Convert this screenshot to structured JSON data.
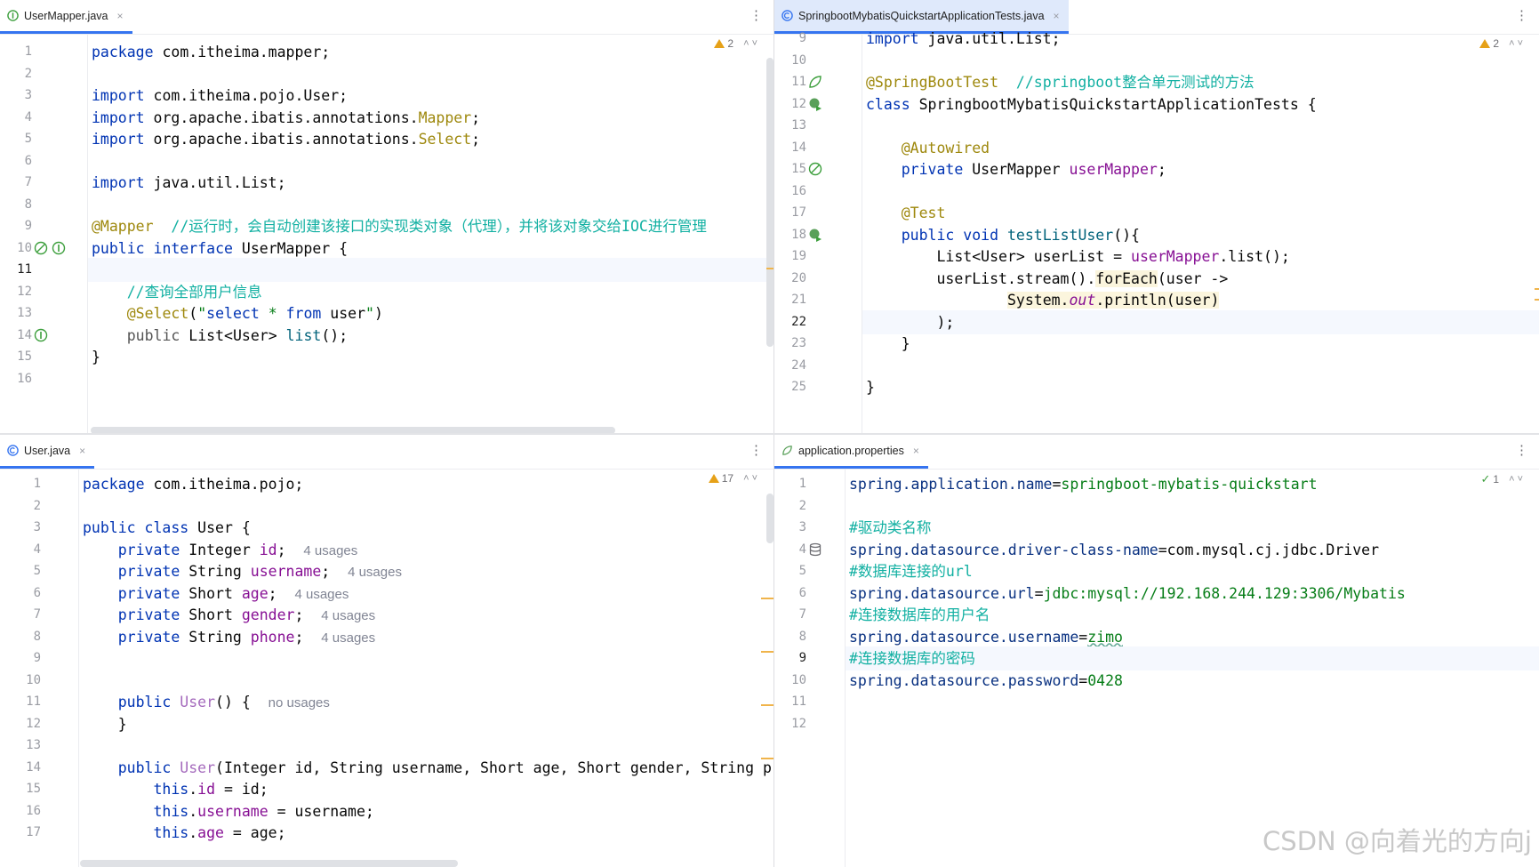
{
  "panes": {
    "mapper": {
      "tab": "UserMapper.java",
      "warnings": "2",
      "lines": [
        {
          "n": "1",
          "html": "<span class='kw'>package</span> com.itheima.mapper;"
        },
        {
          "n": "2",
          "html": ""
        },
        {
          "n": "3",
          "html": "<span class='kw'>import</span> com.itheima.pojo.User;"
        },
        {
          "n": "4",
          "html": "<span class='kw'>import</span> org.apache.ibatis.annotations.<span class='an'>Mapper</span>;"
        },
        {
          "n": "5",
          "html": "<span class='kw'>import</span> org.apache.ibatis.annotations.<span class='an'>Select</span>;"
        },
        {
          "n": "6",
          "html": ""
        },
        {
          "n": "7",
          "html": "<span class='kw'>import</span> java.util.List;"
        },
        {
          "n": "8",
          "html": ""
        },
        {
          "n": "9",
          "html": "<span class='an'>@Mapper</span>  <span class='cmc'>//运行时，会自动创建该接口的实现类对象（代理），并将该对象交给IOC进行管理</span>"
        },
        {
          "n": "10",
          "html": "<span class='kw'>public interface</span> UserMapper {"
        },
        {
          "n": "11",
          "html": ""
        },
        {
          "n": "12",
          "html": "    <span class='cmc'>//查询全部用户信息</span>"
        },
        {
          "n": "13",
          "html": "    <span class='an'>@Select</span>(<span class='str'>\"<span class='kw'>select</span> * <span class='kw'>from</span> <span style='color:#080808'>user</span>\"</span>)"
        },
        {
          "n": "14",
          "html": "    <span style='color:#555'>public</span> List&lt;User&gt; <span class='fn'>list</span>();"
        },
        {
          "n": "15",
          "html": "}"
        },
        {
          "n": "16",
          "html": ""
        }
      ]
    },
    "tests": {
      "tab": "SpringbootMybatisQuickstartApplicationTests.java",
      "warnings": "2",
      "lines": [
        {
          "n": "9",
          "html": "<span class='kw'>import</span> java.util.List;"
        },
        {
          "n": "10",
          "html": ""
        },
        {
          "n": "11",
          "html": "<span class='an'>@SpringBootTest</span>  <span class='cmc'>//springboot整合单元测试的方法</span>"
        },
        {
          "n": "12",
          "html": "<span class='kw'>class</span> SpringbootMybatisQuickstartApplicationTests {"
        },
        {
          "n": "13",
          "html": ""
        },
        {
          "n": "14",
          "html": "    <span class='an'>@Autowired</span>"
        },
        {
          "n": "15",
          "html": "    <span class='kw'>private</span> UserMapper <span class='fld'>userMapper</span>;"
        },
        {
          "n": "16",
          "html": ""
        },
        {
          "n": "17",
          "html": "    <span class='an'>@Test</span>"
        },
        {
          "n": "18",
          "html": "    <span class='kw'>public void</span> <span class='fn'>testListUser</span>(){"
        },
        {
          "n": "19",
          "html": "        List&lt;User&gt; userList = <span class='fld'>userMapper</span>.list();"
        },
        {
          "n": "20",
          "html": "        userList.stream().<span class='hl'>forEach</span>(user -&gt;"
        },
        {
          "n": "21",
          "html": "                <span class='hl'>System.<span class='stat'>out</span>.println(user)</span>"
        },
        {
          "n": "22",
          "html": "        );"
        },
        {
          "n": "23",
          "html": "    }"
        },
        {
          "n": "24",
          "html": ""
        },
        {
          "n": "25",
          "html": "}"
        }
      ]
    },
    "user": {
      "tab": "User.java",
      "warnings": "17",
      "lines": [
        {
          "n": "1",
          "html": "<span class='kw'>package</span> com.itheima.pojo;"
        },
        {
          "n": "2",
          "html": ""
        },
        {
          "n": "3",
          "html": "<span class='kw'>public class</span> User {"
        },
        {
          "n": "4",
          "html": "    <span class='kw'>private</span> Integer <span class='fld'>id</span>;  <span class='hint'>4 usages</span>"
        },
        {
          "n": "5",
          "html": "    <span class='kw'>private</span> String <span class='fld'>username</span>;  <span class='hint'>4 usages</span>"
        },
        {
          "n": "6",
          "html": "    <span class='kw'>private</span> Short <span class='fld'>age</span>;  <span class='hint'>4 usages</span>"
        },
        {
          "n": "7",
          "html": "    <span class='kw'>private</span> Short <span class='fld'>gender</span>;  <span class='hint'>4 usages</span>"
        },
        {
          "n": "8",
          "html": "    <span class='kw'>private</span> String <span class='fld'>phone</span>;  <span class='hint'>4 usages</span>"
        },
        {
          "n": "9",
          "html": ""
        },
        {
          "n": "10",
          "html": ""
        },
        {
          "n": "11",
          "html": "    <span class='kw'>public</span> <span class='fn' style='color:#a56bbd'>User</span>() {  <span class='hint'>no usages</span>"
        },
        {
          "n": "12",
          "html": "    }"
        },
        {
          "n": "13",
          "html": ""
        },
        {
          "n": "14",
          "html": "    <span class='kw'>public</span> <span style='color:#a56bbd'>User</span>(Integer id, String username, Short age, Short gender, String p"
        },
        {
          "n": "15",
          "html": "        <span class='kw'>this</span>.<span class='fld'>id</span> = id;"
        },
        {
          "n": "16",
          "html": "        <span class='kw'>this</span>.<span class='fld'>username</span> = username;"
        },
        {
          "n": "17",
          "html": "        <span class='kw'>this</span>.<span class='fld'>age</span> = age;"
        }
      ]
    },
    "props": {
      "tab": "application.properties",
      "warnings": "1",
      "lines": [
        {
          "n": "1",
          "html": "<span class='prop-key'>spring.application.name</span>=<span class='prop-val'>springboot-mybatis-quickstart</span>"
        },
        {
          "n": "2",
          "html": ""
        },
        {
          "n": "3",
          "html": "<span class='cmc'>#驱动类名称</span>"
        },
        {
          "n": "4",
          "html": "<span class='prop-key'>spring.datasource.driver-class-name</span>=com.mysql.cj.jdbc.Driver"
        },
        {
          "n": "5",
          "html": "<span class='cmc'>#数据库连接的url</span>"
        },
        {
          "n": "6",
          "html": "<span class='prop-key'>spring.datasource.url</span>=<span class='prop-val'>jdbc:mysql://192.168.244.129:3306/Mybatis</span>"
        },
        {
          "n": "7",
          "html": "<span class='cmc'>#连接数据库的用户名</span>"
        },
        {
          "n": "8",
          "html": "<span class='prop-key'>spring.datasource.username</span>=<span class='prop-val' style='text-decoration:underline wavy #6a9'>zimo</span>"
        },
        {
          "n": "9",
          "html": "<span class='cmc'>#连接数据库的密码</span>"
        },
        {
          "n": "10",
          "html": "<span class='prop-key'>spring.datasource.password</span>=<span class='prop-val'>0428</span>"
        },
        {
          "n": "11",
          "html": ""
        },
        {
          "n": "12",
          "html": ""
        }
      ]
    }
  },
  "watermark": "CSDN @向着光的方向j",
  "close_glyph": "×",
  "more_glyph": "⋮",
  "chevrons": "˄ ˅"
}
